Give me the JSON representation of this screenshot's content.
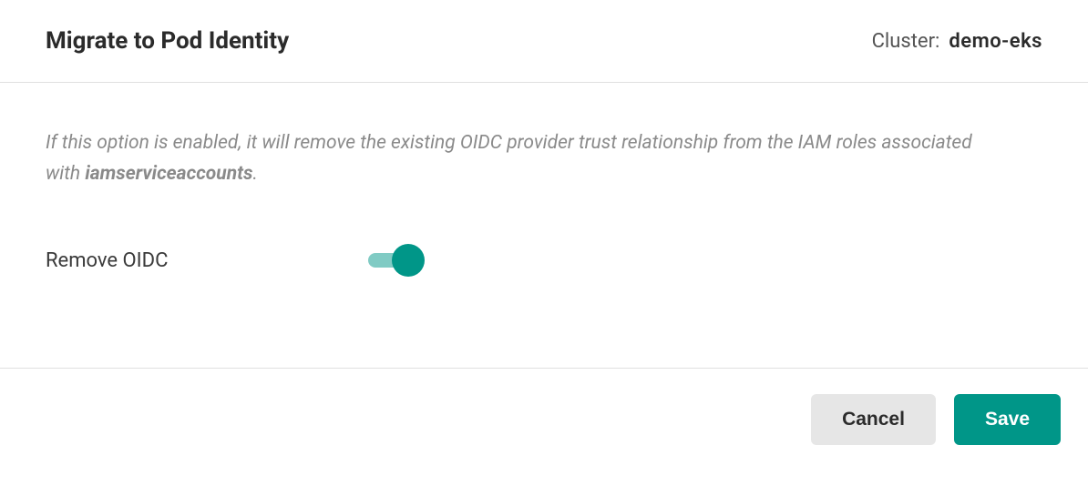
{
  "header": {
    "title": "Migrate to Pod Identity",
    "cluster_label": "Cluster:",
    "cluster_name": "demo-eks"
  },
  "content": {
    "description_prefix": "If this option is enabled, it will remove the existing OIDC provider trust relationship from the IAM roles associated with ",
    "description_bold": "iamserviceaccounts",
    "description_suffix": ".",
    "option_label": "Remove OIDC",
    "toggle_enabled": true
  },
  "footer": {
    "cancel_label": "Cancel",
    "save_label": "Save"
  },
  "colors": {
    "accent": "#009688",
    "accent_light": "#80cbc4"
  }
}
